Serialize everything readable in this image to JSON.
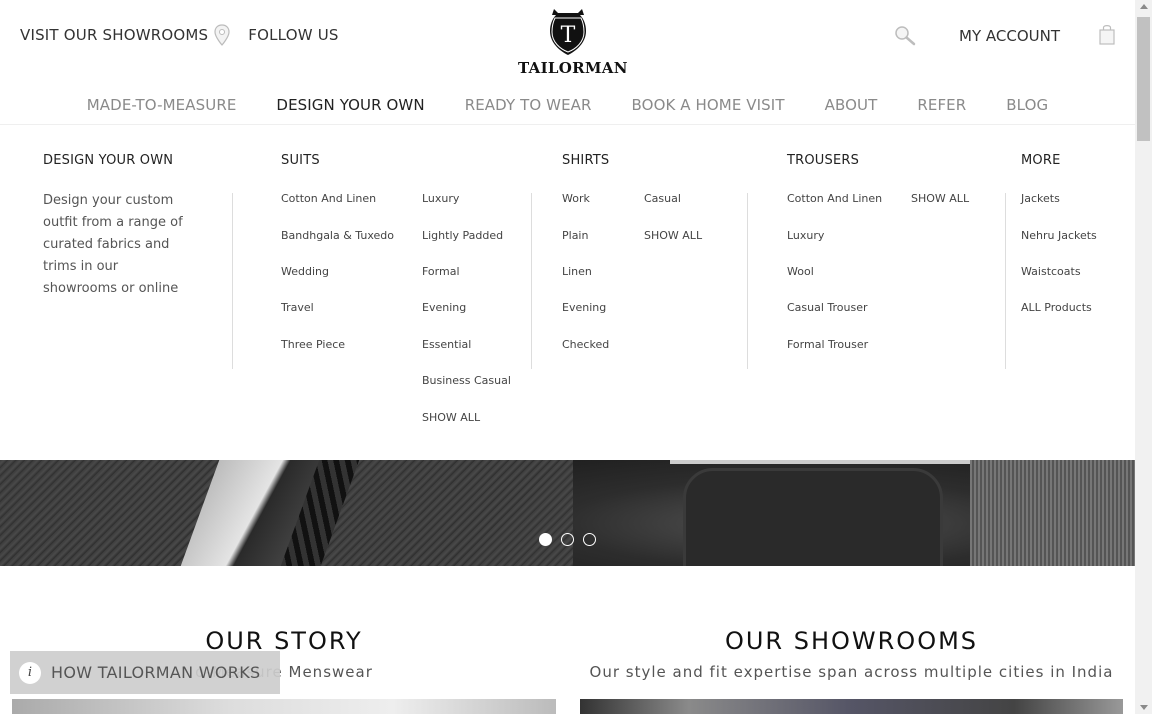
{
  "header": {
    "visit_showrooms": "VISIT OUR SHOWROOMS",
    "follow_us": "FOLLOW US",
    "brand": "TAILORMAN",
    "brand_monogram": "T",
    "my_account": "MY ACCOUNT"
  },
  "nav": [
    {
      "label": "MADE-TO-MEASURE"
    },
    {
      "label": "DESIGN YOUR OWN"
    },
    {
      "label": "READY TO WEAR"
    },
    {
      "label": "BOOK A HOME VISIT"
    },
    {
      "label": "ABOUT"
    },
    {
      "label": "REFER"
    },
    {
      "label": "BLOG"
    }
  ],
  "mega": {
    "intro_title": "DESIGN YOUR OWN",
    "intro_text": "Design your custom outfit from a range of curated fabrics and trims in our showrooms or online",
    "suits": {
      "title": "SUITS",
      "col1": [
        "Cotton And Linen",
        "Bandhgala & Tuxedo",
        "Wedding",
        "Travel",
        "Three Piece"
      ],
      "col2": [
        "Luxury",
        "Lightly Padded",
        "Formal",
        "Evening",
        "Essential",
        "Business Casual",
        "SHOW ALL"
      ]
    },
    "shirts": {
      "title": "SHIRTS",
      "col1": [
        "Work",
        "Plain",
        "Linen",
        "Evening",
        "Checked"
      ],
      "col2": [
        "Casual",
        "SHOW ALL"
      ]
    },
    "trousers": {
      "title": "TROUSERS",
      "col1": [
        "Cotton And Linen",
        "Luxury",
        "Wool",
        "Casual Trouser",
        "Formal Trouser"
      ],
      "col2": [
        "SHOW ALL"
      ]
    },
    "more": {
      "title": "MORE",
      "col1": [
        "Jackets",
        "Nehru Jackets",
        "Waistcoats",
        "ALL Products"
      ]
    }
  },
  "sections": {
    "story_title": "OUR STORY",
    "story_sub": "o-Measure Menswear",
    "showrooms_title": "OUR SHOWROOMS",
    "showrooms_sub": "Our style and fit expertise span across multiple cities in India"
  },
  "how_button": {
    "icon": "i",
    "label": "HOW TAILORMAN WORKS"
  },
  "colors": {
    "nav_inactive": "#8a8a8a",
    "nav_active": "#222222",
    "how_bg": "#cdcdcd"
  }
}
